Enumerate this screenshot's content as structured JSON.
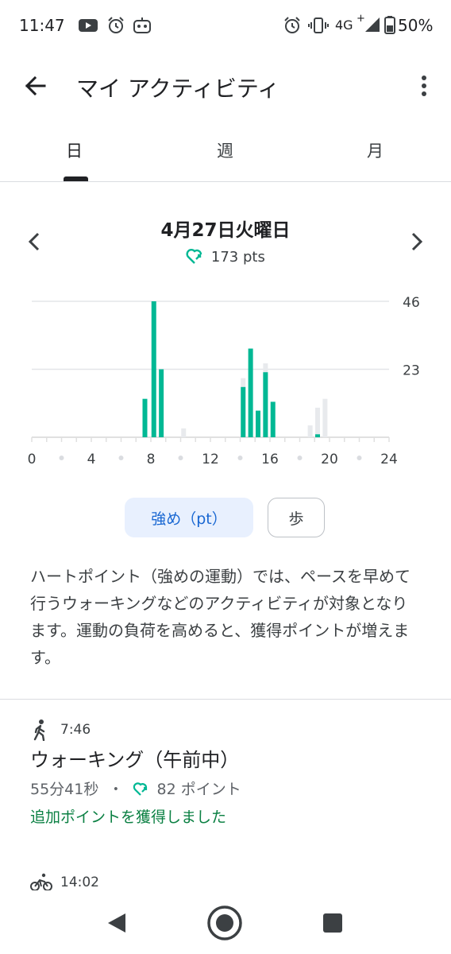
{
  "status_bar": {
    "time": "11:47",
    "network": "4G",
    "network_plus": "+",
    "battery": "50%",
    "left_icons": [
      "youtube-icon",
      "alarm-icon",
      "robot-icon"
    ],
    "right_icons": [
      "alarm-icon",
      "vibrate-icon",
      "signal-icon",
      "battery-icon"
    ]
  },
  "app_bar": {
    "title": "マイ アクティビティ",
    "back_icon": "arrow-back-icon",
    "menu_icon": "more-vert-icon"
  },
  "tabs": [
    {
      "label": "日",
      "selected": true
    },
    {
      "label": "週",
      "selected": false
    },
    {
      "label": "月",
      "selected": false
    }
  ],
  "summary": {
    "date": "4月27日火曜日",
    "points": "173 pts",
    "prev_icon": "chevron-left-icon",
    "next_icon": "chevron-right-icon",
    "heart_icon": "heart-points-icon"
  },
  "chart_data": {
    "type": "bar",
    "x": [
      7.6,
      8.2,
      8.7,
      10.2,
      13.3,
      14.2,
      14.7,
      15.2,
      15.7,
      16.2,
      17.7,
      18.7,
      19.2,
      19.7
    ],
    "series": [
      {
        "values": [
          13,
          46,
          23,
          0,
          0,
          17,
          30,
          9,
          22,
          12,
          0,
          0,
          1,
          0
        ]
      },
      {
        "values": [
          0,
          0,
          0,
          3,
          0,
          20,
          0,
          0,
          25,
          0,
          0,
          4,
          10,
          13
        ]
      }
    ],
    "colors": {
      "intense": "#00b894",
      "other": "#e8eaed",
      "grid": "#e3e5e8",
      "axis": "#e0e0e0"
    },
    "xlim": [
      0,
      24
    ],
    "ylim": [
      0,
      46
    ],
    "x_ticks": [
      "0",
      "4",
      "8",
      "12",
      "16",
      "20",
      "24"
    ],
    "x_tick_values": [
      0,
      4,
      8,
      12,
      16,
      20,
      24
    ],
    "y_ticks": [
      "46",
      "23"
    ],
    "y_tick_values": [
      46,
      23
    ],
    "grid": true
  },
  "toggle": {
    "intense_label": "強め（pt）",
    "steps_label": "歩"
  },
  "description": "ハートポイント（強めの運動）では、ペースを早めて行うウォーキングなどのアクティビティが対象となります。運動の負荷を高めると、獲得ポイントが増えます。",
  "activities": [
    {
      "icon": "walking-icon",
      "time": "7:46",
      "title": "ウォーキング（午前中）",
      "duration": "55分41秒",
      "separator": "・",
      "points": "82 ポイント",
      "bonus": "追加ポイントを獲得しました"
    },
    {
      "icon": "bicycle-icon",
      "time": "14:02"
    }
  ],
  "nav_bar": {
    "back_icon": "nav-back-icon",
    "home_icon": "nav-home-icon",
    "recents_icon": "nav-recents-icon"
  },
  "accent": "#00b894"
}
